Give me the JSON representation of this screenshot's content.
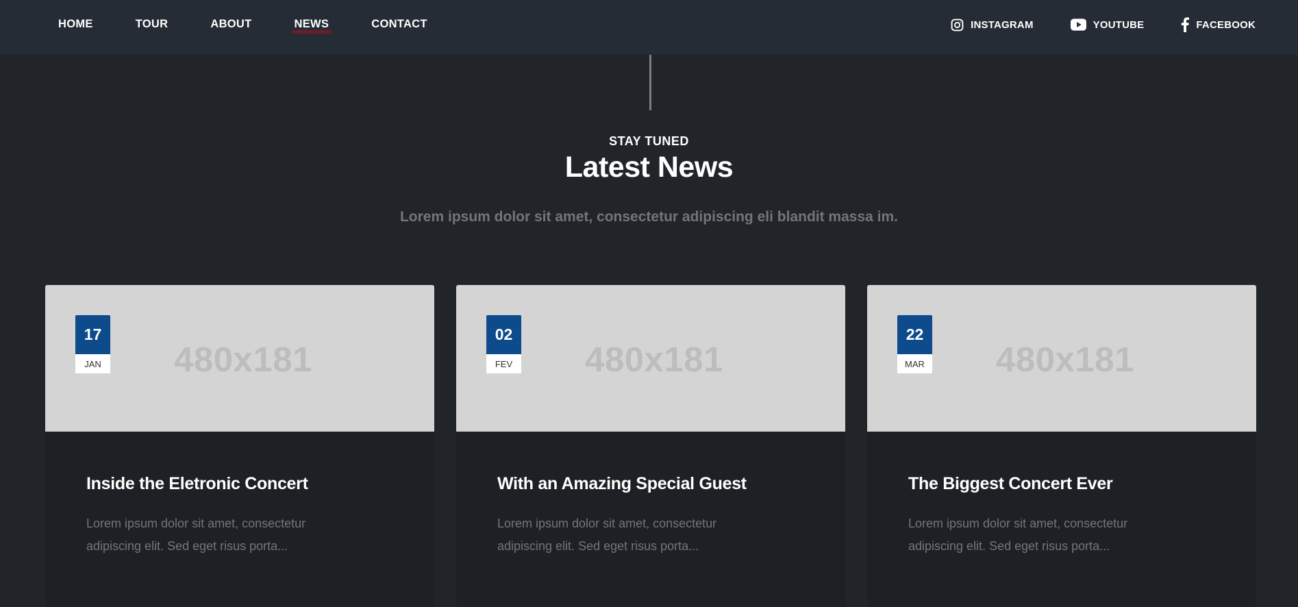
{
  "nav": {
    "items": [
      {
        "label": "HOME",
        "active": false
      },
      {
        "label": "TOUR",
        "active": false
      },
      {
        "label": "ABOUT",
        "active": false
      },
      {
        "label": "NEWS",
        "active": true
      },
      {
        "label": "CONTACT",
        "active": false
      }
    ],
    "social": [
      {
        "label": "INSTAGRAM",
        "icon": "instagram-icon"
      },
      {
        "label": "YOUTUBE",
        "icon": "youtube-icon"
      },
      {
        "label": "FACEBOOK",
        "icon": "facebook-icon"
      }
    ]
  },
  "header": {
    "eyebrow": "STAY TUNED",
    "title": "Latest News",
    "subtitle": "Lorem ipsum dolor sit amet, consectetur adipiscing eli blandit massa im."
  },
  "cards": [
    {
      "image_placeholder": "480x181",
      "day": "17",
      "month": "JAN",
      "title": "Inside the Eletronic Concert",
      "excerpt": "Lorem ipsum dolor sit amet, consectetur adipiscing elit. Sed eget risus porta..."
    },
    {
      "image_placeholder": "480x181",
      "day": "02",
      "month": "FEV",
      "title": "With an Amazing Special Guest",
      "excerpt": "Lorem ipsum dolor sit amet, consectetur adipiscing elit. Sed eget risus porta..."
    },
    {
      "image_placeholder": "480x181",
      "day": "22",
      "month": "MAR",
      "title": "The Biggest Concert Ever",
      "excerpt": "Lorem ipsum dolor sit amet, consectetur adipiscing elit. Sed eget risus porta..."
    }
  ],
  "colors": {
    "background": "#212529",
    "topbar": "#252c35",
    "badge": "#0d4b8c",
    "active_underline": "#7a1b22",
    "placeholder_bg": "#d4d4d4",
    "muted_text": "#72767a"
  }
}
